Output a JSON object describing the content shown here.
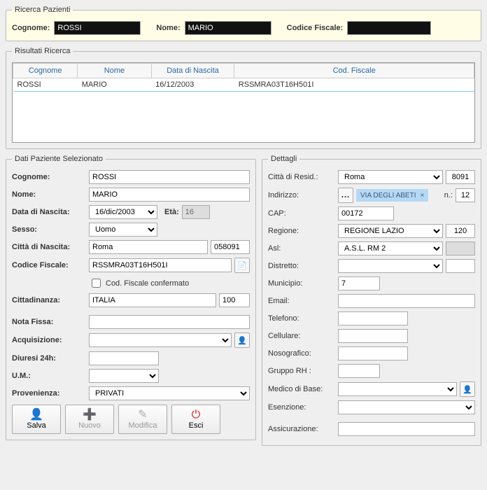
{
  "search_panel": {
    "legend": "Ricerca Pazienti",
    "cognome_lbl": "Cognome:",
    "cognome_val": "ROSSI",
    "nome_lbl": "Nome:",
    "nome_val": "MARIO",
    "cf_lbl": "Codice Fiscale:",
    "cf_val": ""
  },
  "results_panel": {
    "legend": "Risultati Ricerca",
    "headers": {
      "cognome": "Cognome",
      "nome": "Nome",
      "ddn": "Data di Nascita",
      "cf": "Cod. Fiscale"
    },
    "rows": [
      {
        "cognome": "ROSSI",
        "nome": "MARIO",
        "ddn": "16/12/2003",
        "cf": "RSSMRA03T16H501I"
      }
    ]
  },
  "patient_panel": {
    "legend": "Dati Paziente Selezionato",
    "cognome_lbl": "Cognome:",
    "cognome_val": "ROSSI",
    "nome_lbl": "Nome:",
    "nome_val": "MARIO",
    "ddn_lbl": "Data di Nascita:",
    "ddn_val": "16/dic/2003",
    "eta_lbl": "Età:",
    "eta_val": "16",
    "sesso_lbl": "Sesso:",
    "sesso_val": "Uomo",
    "citta_nascita_lbl": "Città di Nascita:",
    "citta_nascita_val": "Roma",
    "citta_nascita_code": "058091",
    "cf_lbl": "Codice Fiscale:",
    "cf_val": "RSSMRA03T16H501I",
    "cf_confirm_lbl": "Cod. Fiscale confermato",
    "cittadinanza_lbl": "Cittadinanza:",
    "cittadinanza_val": "ITALIA",
    "cittadinanza_code": "100",
    "nota_lbl": "Nota Fissa:",
    "acq_lbl": "Acquisizione:",
    "diuresi_lbl": "Diuresi 24h:",
    "um_lbl": "U.M.:",
    "prov_lbl": "Provenienza:",
    "prov_val": "PRIVATI"
  },
  "details_panel": {
    "legend": "Dettagli",
    "citta_res_lbl": "Città di Resid.:",
    "citta_res_val": "Roma",
    "citta_res_code": "8091",
    "indirizzo_lbl": "Indirizzo:",
    "indirizzo_tag": "VIA DEGLI ABETI",
    "indirizzo_n_lbl": "n.:",
    "indirizzo_n_val": "12",
    "cap_lbl": "CAP:",
    "cap_val": "00172",
    "regione_lbl": "Regione:",
    "regione_val": "REGIONE LAZIO",
    "regione_code": "120",
    "asl_lbl": "Asl:",
    "asl_val": "A.S.L. RM 2",
    "distretto_lbl": "Distretto:",
    "municipio_lbl": "Municipio:",
    "municipio_val": "7",
    "email_lbl": "Email:",
    "telefono_lbl": "Telefono:",
    "cellulare_lbl": "Cellulare:",
    "nosografico_lbl": "Nosografico:",
    "grupporh_lbl": "Gruppo RH :",
    "medico_lbl": "Medico di Base:",
    "esenzione_lbl": "Esenzione:",
    "assicurazione_lbl": "Assicurazione:"
  },
  "buttons": {
    "salva": "Salva",
    "nuovo": "Nuovo",
    "modifica": "Modifica",
    "esci": "Esci"
  }
}
